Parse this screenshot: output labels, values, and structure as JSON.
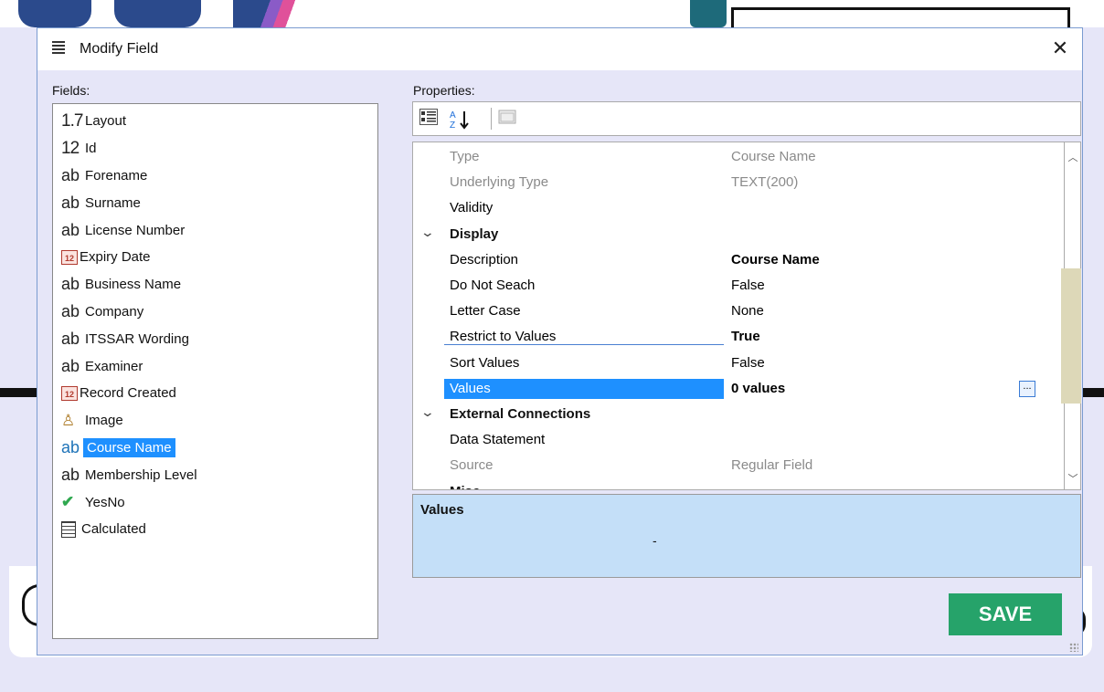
{
  "dialog": {
    "title": "Modify Field",
    "close_glyph": "✕"
  },
  "fields": {
    "label": "Fields:",
    "items": [
      {
        "icon": "1.7",
        "icon_kind": "num",
        "label": "Layout"
      },
      {
        "icon": "12",
        "icon_kind": "num",
        "label": "Id"
      },
      {
        "icon": "ab",
        "icon_kind": "ab",
        "label": "Forename"
      },
      {
        "icon": "ab",
        "icon_kind": "ab",
        "label": "Surname"
      },
      {
        "icon": "ab",
        "icon_kind": "ab",
        "label": "License Number"
      },
      {
        "icon": "12",
        "icon_kind": "cal",
        "label": "Expiry Date"
      },
      {
        "icon": "ab",
        "icon_kind": "ab",
        "label": "Business Name"
      },
      {
        "icon": "ab",
        "icon_kind": "ab",
        "label": "Company"
      },
      {
        "icon": "ab",
        "icon_kind": "ab",
        "label": "ITSSAR Wording"
      },
      {
        "icon": "ab",
        "icon_kind": "ab",
        "label": "Examiner"
      },
      {
        "icon": "12",
        "icon_kind": "cal",
        "label": "Record Created"
      },
      {
        "icon": "♙",
        "icon_kind": "img",
        "label": "Image"
      },
      {
        "icon": "ab",
        "icon_kind": "ab",
        "label": "Course Name"
      },
      {
        "icon": "ab",
        "icon_kind": "ab",
        "label": "Membership Level"
      },
      {
        "icon": "✔",
        "icon_kind": "chk",
        "label": "YesNo"
      },
      {
        "icon": "",
        "icon_kind": "calc",
        "label": "Calculated"
      }
    ],
    "selected": "Course Name"
  },
  "properties": {
    "label": "Properties:",
    "rows": [
      {
        "name": "Type",
        "value": "Course Name",
        "style": "dim"
      },
      {
        "name": "Underlying Type",
        "value": "TEXT(200)",
        "style": "dim"
      },
      {
        "name": "Validity",
        "value": "",
        "style": ""
      },
      {
        "name": "Display",
        "value": "",
        "style": "cat"
      },
      {
        "name": "Description",
        "value": "Course Name",
        "style": "bold"
      },
      {
        "name": "Do Not Seach",
        "value": "False",
        "style": ""
      },
      {
        "name": "Letter Case",
        "value": "None",
        "style": ""
      },
      {
        "name": "Restrict to Values",
        "value": "True",
        "style": "bold underline"
      },
      {
        "name": "Sort Values",
        "value": "False",
        "style": ""
      },
      {
        "name": "Values",
        "value": "0 values",
        "style": "bold sel"
      },
      {
        "name": "External Connections",
        "value": "",
        "style": "cat"
      },
      {
        "name": "Data Statement",
        "value": "",
        "style": ""
      },
      {
        "name": "Source",
        "value": "Regular Field",
        "style": "dim"
      },
      {
        "name": "Misc",
        "value": "",
        "style": "cat"
      }
    ],
    "ellipsis_label": "..."
  },
  "description_panel": {
    "title": "Values",
    "text": "-"
  },
  "save_button": {
    "label": "SAVE",
    "color": "#26a36a"
  },
  "accent_color": "#1e90ff"
}
